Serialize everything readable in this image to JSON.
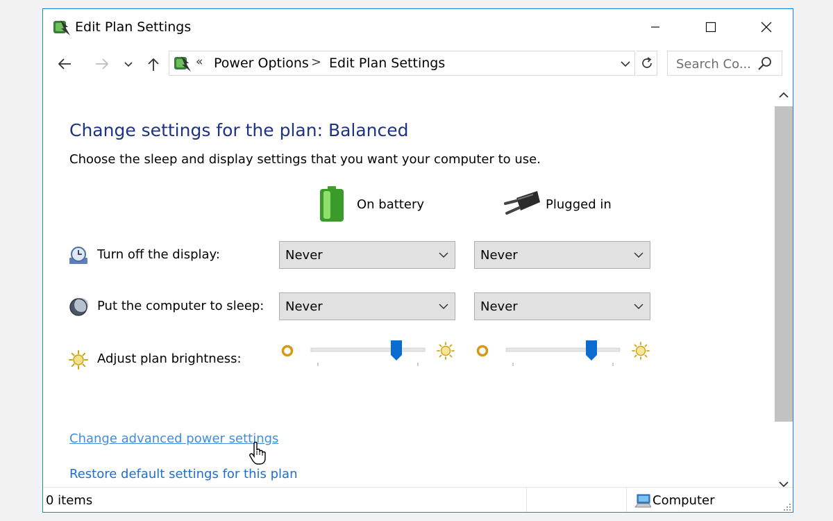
{
  "window": {
    "title": "Edit Plan Settings",
    "accent": "#1883d7"
  },
  "titlebar": {
    "app_icon": "power-options-icon",
    "buttons": [
      "minimize",
      "maximize",
      "close"
    ]
  },
  "nav": {
    "back_icon": "arrow-left-icon",
    "forward_icon": "arrow-right-icon",
    "recent_icon": "chevron-down-icon",
    "up_icon": "arrow-up-icon",
    "address": {
      "overflow": "«",
      "crumbs": [
        "Power Options",
        "Edit Plan Settings"
      ],
      "separator": ">"
    },
    "search_placeholder": "Search Co..."
  },
  "content": {
    "heading": "Change settings for the plan: Balanced",
    "heading_color": "#1e3287",
    "subheading": "Choose the sleep and display settings that you want your computer to use.",
    "columns": {
      "battery": "On battery",
      "plugged": "Plugged in"
    },
    "settings": [
      {
        "label": "Turn off the display:",
        "icon": "monitor-clock-icon",
        "battery": "Never",
        "plugged": "Never"
      },
      {
        "label": "Put the computer to sleep:",
        "icon": "moon-icon",
        "battery": "Never",
        "plugged": "Never"
      }
    ],
    "brightness": {
      "label": "Adjust plan brightness:",
      "icon": "brightness-icon",
      "battery_level": 0.75,
      "plugged_level": 0.75
    },
    "links": {
      "advanced": "Change advanced power settings",
      "restore": "Restore default settings for this plan"
    },
    "link_color": "#1a6fd2"
  },
  "statusbar": {
    "items": "0 items",
    "zone": "Computer",
    "zone_icon": "computer-icon"
  }
}
